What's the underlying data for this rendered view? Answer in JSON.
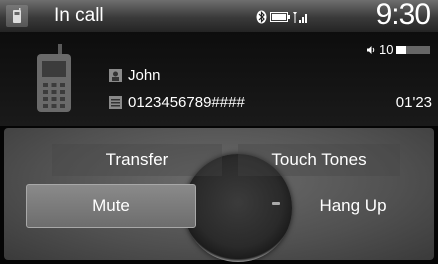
{
  "status_bar": {
    "title": "In call",
    "time": "9:30",
    "icons": [
      "phone-icon",
      "bluetooth-icon",
      "battery-icon",
      "signal-icon"
    ]
  },
  "call": {
    "volume": "10",
    "volume_level": 0.3,
    "contact_name": "John",
    "number": "0123456789####",
    "duration": "01'23"
  },
  "controls": {
    "transfer_label": "Transfer",
    "touch_tones_label": "Touch Tones",
    "mute_label": "Mute",
    "hang_up_label": "Hang Up"
  },
  "colors": {
    "background": "#050505",
    "text": "#ffffff",
    "selected_button": "#8a8a8a"
  }
}
